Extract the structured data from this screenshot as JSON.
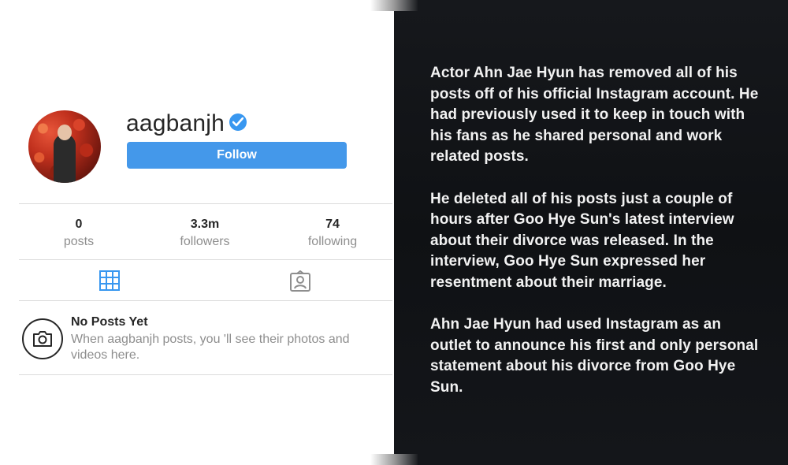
{
  "profile": {
    "username": "aagbanjh",
    "follow_label": "Follow",
    "stats": [
      {
        "value": "0",
        "label": "posts"
      },
      {
        "value": "3.3m",
        "label": "followers"
      },
      {
        "value": "74",
        "label": "following"
      }
    ],
    "tabs": [
      "grid-icon",
      "tagged-icon"
    ],
    "empty_title": "No Posts Yet",
    "empty_description": "When aagbanjh posts, you 'll see their photos and videos here."
  },
  "caption": {
    "paragraphs": [
      "Actor Ahn Jae Hyun has removed all of his posts off of his official Instagram account. He had previously used it to keep in touch with his fans as he shared personal and work related posts.",
      "He deleted all of his posts just a couple of hours after Goo Hye Sun's latest interview about their divorce was released. In the interview, Goo Hye Sun expressed her resentment about their marriage.",
      "Ahn Jae Hyun had used Instagram as an outlet to announce his first and only personal statement about his divorce from Goo Hye Sun."
    ]
  },
  "colors": {
    "follow_button": "#4498ea",
    "verified_badge": "#3897f0",
    "active_tab": "#3897f0",
    "dark_panel": "#111317"
  }
}
